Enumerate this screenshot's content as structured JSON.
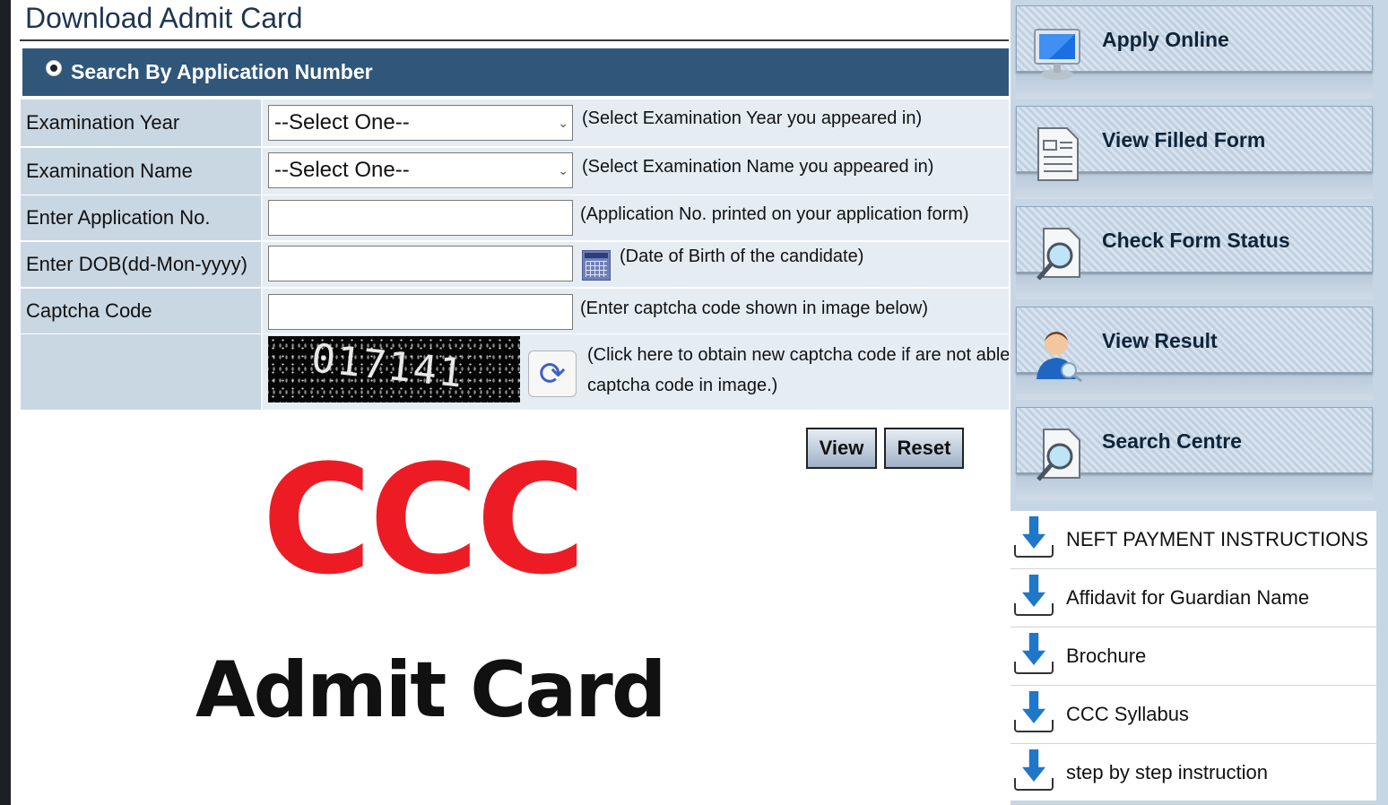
{
  "page": {
    "title": "Download Admit Card",
    "search_option": "Search By Application Number"
  },
  "form": {
    "rows": [
      {
        "label": "Examination Year",
        "control": "select",
        "value": "--Select One--",
        "hint": "(Select Examination Year you appeared in)"
      },
      {
        "label": "Examination Name",
        "control": "select",
        "value": "--Select One--",
        "hint": "(Select Examination Name you appeared in)"
      },
      {
        "label": "Enter Application No.",
        "control": "input",
        "value": "",
        "hint": "(Application No. printed on your application form)"
      },
      {
        "label": "Enter DOB(dd-Mon-yyyy)",
        "control": "input",
        "value": "",
        "hint": "(Date of Birth of the candidate)"
      },
      {
        "label": "Captcha Code",
        "control": "input",
        "value": "",
        "hint": "(Enter captcha code shown in image below)"
      }
    ],
    "captcha": {
      "image_text": "017141",
      "hint_line1": "(Click here to obtain new captcha code if are not able",
      "hint_line2": "captcha code in image.)"
    },
    "buttons": {
      "view": "View",
      "reset": "Reset"
    }
  },
  "banner": {
    "logo_text": "CCC",
    "subtitle": "Admit Card",
    "logo_color": "#ed1c24"
  },
  "sidebar": {
    "tiles": [
      {
        "label": "Apply Online",
        "icon": "monitor-icon"
      },
      {
        "label": "View Filled Form",
        "icon": "document-icon"
      },
      {
        "label": "Check Form Status",
        "icon": "magnifier-icon"
      },
      {
        "label": "View Result",
        "icon": "user-search-icon"
      },
      {
        "label": "Search Centre",
        "icon": "magnifier-icon"
      }
    ],
    "downloads": [
      {
        "label": "NEFT PAYMENT INSTRUCTIONS"
      },
      {
        "label": "Affidavit for Guardian Name"
      },
      {
        "label": "Brochure"
      },
      {
        "label": "CCC Syllabus"
      },
      {
        "label": "step by step instruction"
      }
    ]
  },
  "colors": {
    "header_bar": "#30577a",
    "label_cell": "#c9d7e3",
    "sidebar_bg": "#c7d6e5",
    "download_arrow": "#1e77c9"
  }
}
